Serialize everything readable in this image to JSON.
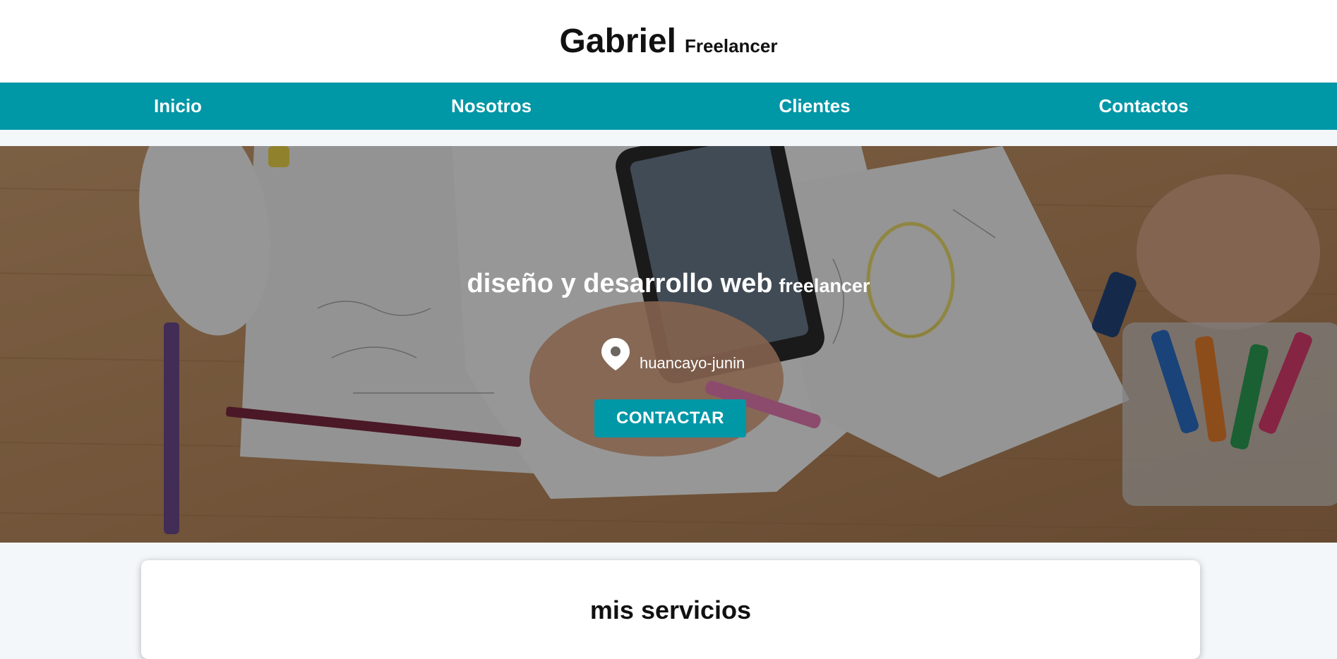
{
  "brand": {
    "name": "Gabriel",
    "tagline": "Freelancer"
  },
  "nav": {
    "items": [
      "Inicio",
      "Nosotros",
      "Clientes",
      "Contactos"
    ]
  },
  "hero": {
    "title_main": "diseño y desarrollo web",
    "title_sub": "freelancer",
    "location": "huancayo-junin",
    "location_icon": "map-pin-icon",
    "cta_label": "CONTACTAR"
  },
  "services": {
    "title": "mis servicios"
  },
  "colors": {
    "accent": "#0097a7",
    "header_bg": "#ffffff",
    "page_bg": "#f3f7fa"
  }
}
